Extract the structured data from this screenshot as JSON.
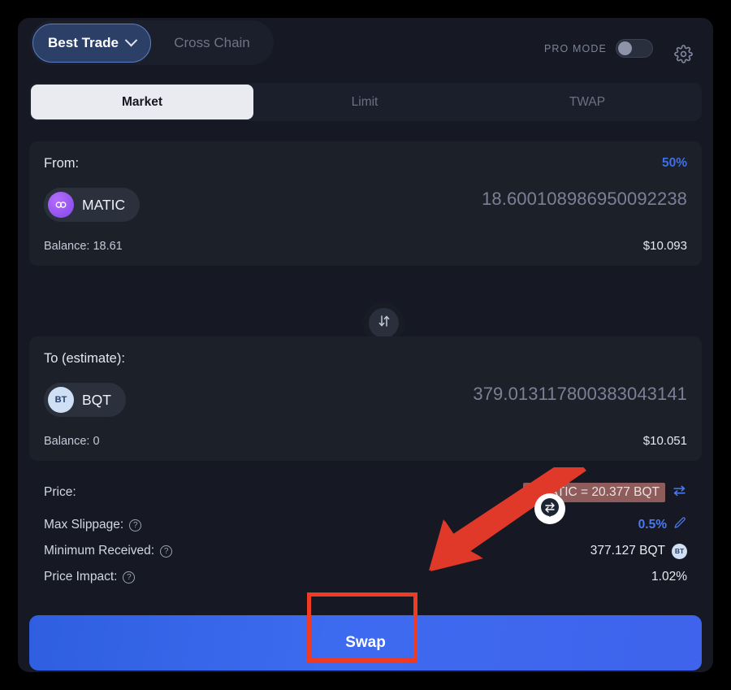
{
  "topbar": {
    "mode_active": "Best Trade",
    "mode_inactive": "Cross Chain",
    "pro_mode_label": "PRO MODE",
    "pro_mode_state": "off",
    "settings_icon": "gear-icon",
    "chevron_icon": "chevron-down-icon"
  },
  "order_tabs": [
    {
      "label": "Market",
      "active": true
    },
    {
      "label": "Limit",
      "active": false
    },
    {
      "label": "TWAP",
      "active": false
    }
  ],
  "from_panel": {
    "heading": "From:",
    "percent_shortcut": "50%",
    "token_symbol": "MATIC",
    "token_logo": "matic-logo-icon",
    "amount": "18.600108986950092238",
    "balance": "Balance: 18.61",
    "usd_value": "$10.093"
  },
  "flip_button": {
    "icon": "swap-vertical-arrows-icon"
  },
  "to_panel": {
    "heading": "To (estimate):",
    "token_symbol": "BQT",
    "token_logo": "bqt-logo-icon",
    "token_logo_text": "BT",
    "amount": "379.013117800383043141",
    "balance": "Balance: 0",
    "usd_value": "$10.051"
  },
  "details": {
    "price": {
      "label": "Price:",
      "value": "1 MATIC = 20.377 BQT",
      "toggle_icon": "swap-horizontal-arrows-icon",
      "highlighted": true,
      "highlight_color": "#8f5c5c"
    },
    "max_slippage": {
      "label": "Max Slippage:",
      "help_icon": "question-circle-icon",
      "value": "0.5%",
      "edit_icon": "pencil-edit-icon"
    },
    "minimum_received": {
      "label": "Minimum Received:",
      "help_icon": "question-circle-icon",
      "value": "377.127 BQT",
      "badge_text": "BT"
    },
    "price_impact": {
      "label": "Price Impact:",
      "help_icon": "question-circle-icon",
      "value": "1.02%"
    }
  },
  "cta": {
    "swap_label": "Swap"
  },
  "annotations": {
    "highlight_box_target": "swap-button",
    "highlight_box_color": "#ef3b21",
    "arrow_color": "#e0392a",
    "cursor_marker": "mouse-cursor-marker"
  },
  "colors": {
    "accent_blue": "#3f6fe8",
    "card_bg": "#161923",
    "panel_bg": "#1c2029",
    "page_bg": "#000000"
  }
}
